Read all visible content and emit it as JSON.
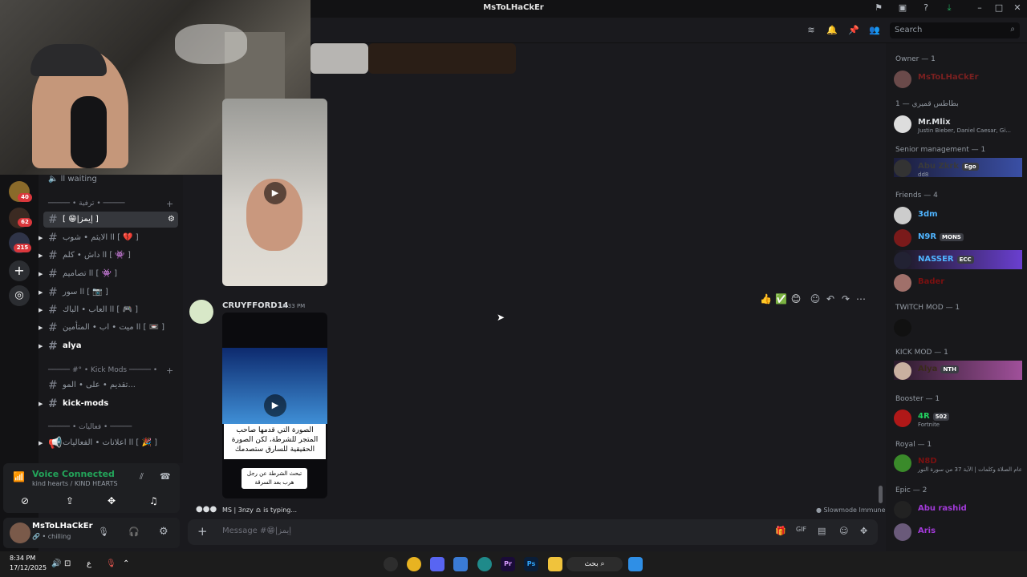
{
  "window": {
    "title": "MsToLHaCkEr"
  },
  "search": {
    "placeholder": "Search"
  },
  "sidebar": {
    "voice_channel": "ll waiting",
    "category_1": "───── • ترفية • ─────",
    "channels": [
      {
        "label": "[ 😁|إيمز ]",
        "active": true
      },
      {
        "label": "الايثم • شوب ll [ 💔 ]"
      },
      {
        "label": "داش • كلم ll [ 👾 ]"
      },
      {
        "label": "تصاميم ll [ 👾 ]"
      },
      {
        "label": "سور ll [ 📷 ]"
      },
      {
        "label": "العاب • الباك ll [ 🎮 ]"
      },
      {
        "label": "ميت • اب • المتأمين ll [ 📼 ]"
      },
      {
        "label": "alya"
      }
    ],
    "category_2": "───── #° • Kick Mods ───── •",
    "kick_channels": [
      {
        "label": "تقديم • على • المو..."
      },
      {
        "label": "kick-mods"
      }
    ],
    "category_3": "───── • فعاليات • ─────",
    "event_channel": "اعلانات • الفعاليات ll [ 🎉 ]"
  },
  "servers": [
    {
      "badge": "40"
    },
    {
      "badge": "62"
    },
    {
      "badge": "215"
    }
  ],
  "voice": {
    "status": "Voice Connected",
    "channel": "kind hearts / KIND HEARTS"
  },
  "user": {
    "name": "MsToLHaCkEr",
    "status": "chilling"
  },
  "chat": {
    "author": "CRUYFFORD14",
    "time": "8:33 PM",
    "caption_main": "الصورة التي قدمها صاحب المتجر للشرطة، لكن الصورة الحقيقية للسارق ستصدمك",
    "caption_sub": "تبحث الشرطة عن رجل هرب بعد السرقة",
    "typing": "MS | 3nzy ♎ is typing...",
    "slowmode": "Slowmode Immune",
    "composer_placeholder": "Message #😁|إيمز"
  },
  "members": {
    "roles": [
      "Owner — 1",
      "بطاطس قميري — 1",
      "Senior management — 1",
      "Friends — 4",
      "TWITCH MOD — 1",
      "KICK MOD — 1",
      "Booster — 1",
      "Royal — 1",
      "Epic — 2"
    ],
    "owner": {
      "name": "MsToLHaCkEr"
    },
    "mid": {
      "name": "Mr.Mlix",
      "activity": "Justin Bieber, Daniel Caesar, Gi..."
    },
    "senior": {
      "name": "Abu Zkrk",
      "tag": "Ego",
      "sub": "dd8"
    },
    "friends": [
      {
        "name": "3dm"
      },
      {
        "name": "N9R",
        "tag": "MONS"
      },
      {
        "name": "NASSER",
        "tag": "ECC"
      },
      {
        "name": "Bader"
      }
    ],
    "kick": {
      "name": "Alya",
      "tag": "NTH"
    },
    "booster": {
      "name": "4R",
      "tag": "502",
      "sub": "Fortnite"
    },
    "royal": {
      "name": "N8D",
      "sub": "عام الصلاة وكلمات | الآية 37 من سورة النور"
    },
    "epic": [
      {
        "name": "Abu rashid"
      },
      {
        "name": "Aris"
      }
    ]
  },
  "taskbar": {
    "time": "8:34 PM",
    "date": "17/12/2025",
    "search": "بحث",
    "lang": "ع"
  }
}
